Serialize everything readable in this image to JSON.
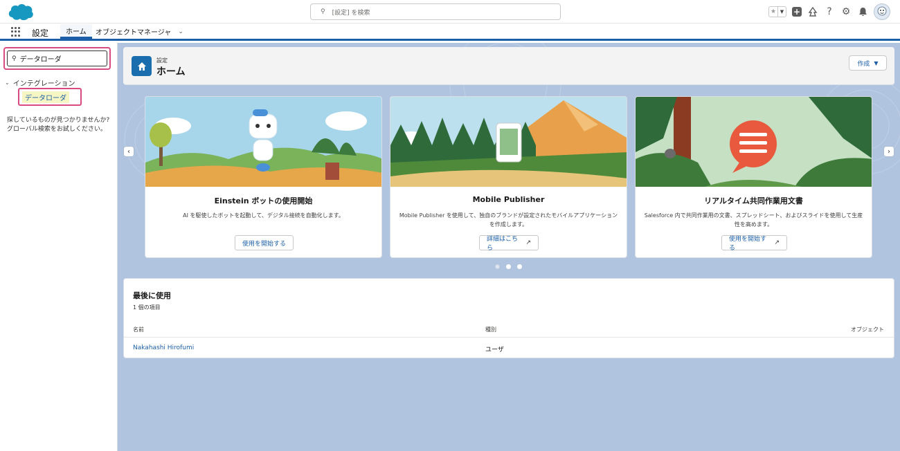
{
  "global_header": {
    "search_placeholder": "[設定] を検索"
  },
  "nav": {
    "app_name": "設定",
    "tabs": [
      {
        "label": "ホーム",
        "active": true
      },
      {
        "label": "オブジェクトマネージャ"
      }
    ]
  },
  "sidebar": {
    "quick_find_value": "データローダ",
    "group_label": "インテグレーション",
    "item_label": "データローダ",
    "not_found_line1": "探しているものが見つかりませんか?",
    "not_found_line2": "グローバル検索をお試しください。"
  },
  "page_header": {
    "eyebrow": "設定",
    "title": "ホーム",
    "create_button": "作成"
  },
  "carousel": {
    "cards": [
      {
        "title": "Einstein ボットの使用開始",
        "description": "AI を駆使したボットを起動して、デジタル接続を自動化します。",
        "button": "使用を開始する",
        "external": false
      },
      {
        "title": "Mobile Publisher",
        "description": "Mobile Publisher を使用して、独自のブランドが設定されたモバイルアプリケーションを作成します。",
        "button": "詳細はこちら",
        "external": true
      },
      {
        "title": "リアルタイム共同作業用文書",
        "description": "Salesforce 内で共同作業用の文書、スプレッドシート、およびスライドを使用して生産性を高めます。",
        "button": "使用を開始する",
        "external": true
      }
    ],
    "page_count": 3,
    "active_page": 2
  },
  "recent": {
    "title": "最後に使用",
    "count": "1 個の項目",
    "columns": [
      "名前",
      "種別",
      "オブジェクト"
    ],
    "rows": [
      {
        "name": "Nakahashi Hirofumi",
        "type": "ユーザ",
        "object": ""
      }
    ]
  },
  "colors": {
    "brand_blue": "#1b5fa8",
    "highlight_pink": "#d94b80",
    "background": "#b0c4df"
  }
}
